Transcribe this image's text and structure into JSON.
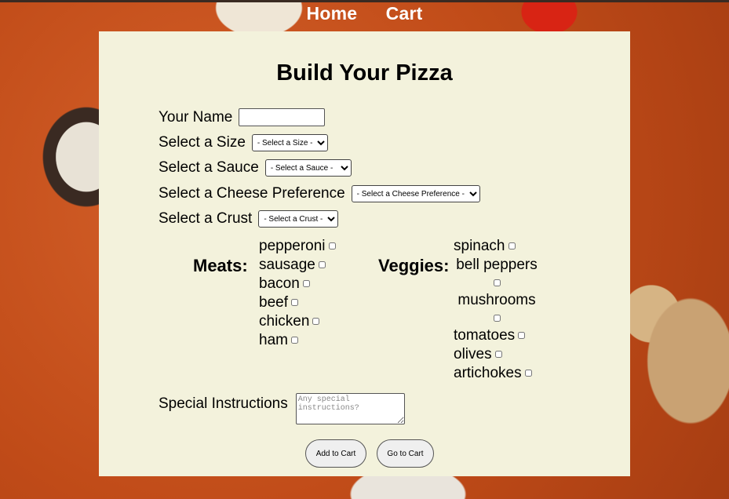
{
  "nav": {
    "home": "Home",
    "cart": "Cart"
  },
  "form": {
    "title": "Build Your Pizza",
    "name_label": "Your Name",
    "name_value": "",
    "size_label": "Select a Size",
    "size_selected": "- Select a Size -",
    "sauce_label": "Select a Sauce",
    "sauce_selected": "- Select a Sauce -",
    "cheese_label": "Select a Cheese Preference",
    "cheese_selected": "- Select a Cheese Preference -",
    "crust_label": "Select a Crust",
    "crust_selected": "- Select a Crust -",
    "meats_title": "Meats:",
    "meats": [
      "pepperoni",
      "sausage",
      "bacon",
      "beef",
      "chicken",
      "ham"
    ],
    "veggies_title": "Veggies:",
    "veggies": [
      "spinach",
      "bell peppers",
      "mushrooms",
      "tomatoes",
      "olives",
      "artichokes"
    ],
    "special_label": "Special Instructions",
    "special_placeholder": "Any special instructions?",
    "add_button": "Add to Cart",
    "go_button": "Go to Cart"
  }
}
